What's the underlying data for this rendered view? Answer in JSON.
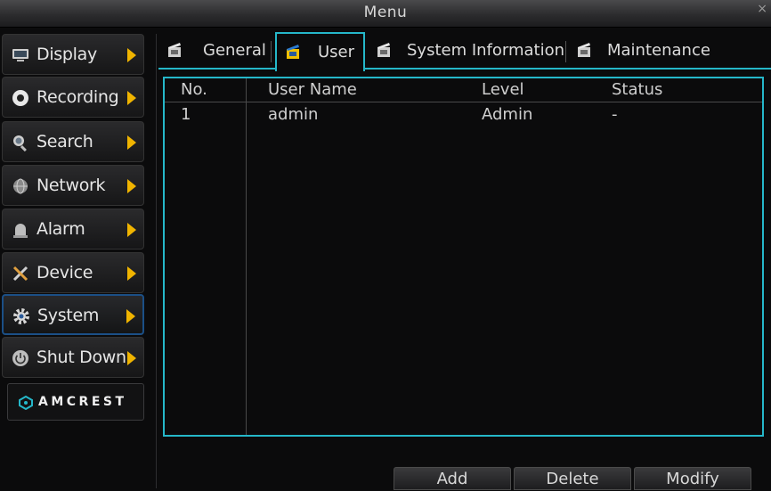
{
  "window": {
    "title": "Menu",
    "close": "×"
  },
  "sidebar": {
    "items": [
      {
        "label": "Display"
      },
      {
        "label": "Recording"
      },
      {
        "label": "Search"
      },
      {
        "label": "Network"
      },
      {
        "label": "Alarm"
      },
      {
        "label": "Device"
      },
      {
        "label": "System",
        "active": true
      },
      {
        "label": "Shut Down"
      }
    ],
    "brand": "AMCREST"
  },
  "tabs": [
    {
      "label": "General"
    },
    {
      "label": "User",
      "active": true
    },
    {
      "label": "System Information"
    },
    {
      "label": "Maintenance"
    }
  ],
  "table": {
    "columns": [
      "No.",
      "User Name",
      "Level",
      "Status"
    ],
    "rows": [
      [
        "1",
        "admin",
        "Admin",
        "-"
      ]
    ]
  },
  "buttons": {
    "add": "Add",
    "delete": "Delete",
    "modify": "Modify"
  },
  "colors": {
    "accent": "#25b7c9",
    "arrow": "#f0b400",
    "active_border": "#1b4f86"
  }
}
